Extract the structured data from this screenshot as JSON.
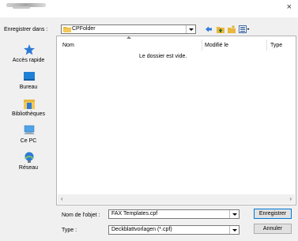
{
  "window": {
    "close_glyph": "×"
  },
  "location": {
    "label": "Enregistrer dans :",
    "value": "CPFolder",
    "folder_icon": "folder-icon"
  },
  "toolbar": {
    "back_icon": "back-arrow-icon",
    "up_icon": "up-folder-icon",
    "new_folder_icon": "new-folder-icon",
    "view_menu_icon": "view-menu-icon"
  },
  "places": [
    {
      "label": "Accès rapide",
      "icon": "star-icon"
    },
    {
      "label": "Bureau",
      "icon": "desktop-icon"
    },
    {
      "label": "Bibliothèques",
      "icon": "libraries-icon"
    },
    {
      "label": "Ce PC",
      "icon": "computer-icon"
    },
    {
      "label": "Réseau",
      "icon": "network-icon"
    }
  ],
  "file_list": {
    "columns": [
      "Nom",
      "Modifié le",
      "Type"
    ],
    "empty_message": "Le dossier est vide."
  },
  "scrollbar": {
    "left_glyph": "‹",
    "right_glyph": "›"
  },
  "form": {
    "filename_label": "Nom de l'objet :",
    "filename_value": "FAX Templates.cpf",
    "type_label": "Type :",
    "type_value": "Deckblattvorlagen (*.cpf)"
  },
  "buttons": {
    "save": "Enregistrer",
    "cancel": "Annuler"
  },
  "colors": {
    "accent": "#0078d7",
    "folder": "#e8b73c",
    "star": "#2d7ad6"
  }
}
